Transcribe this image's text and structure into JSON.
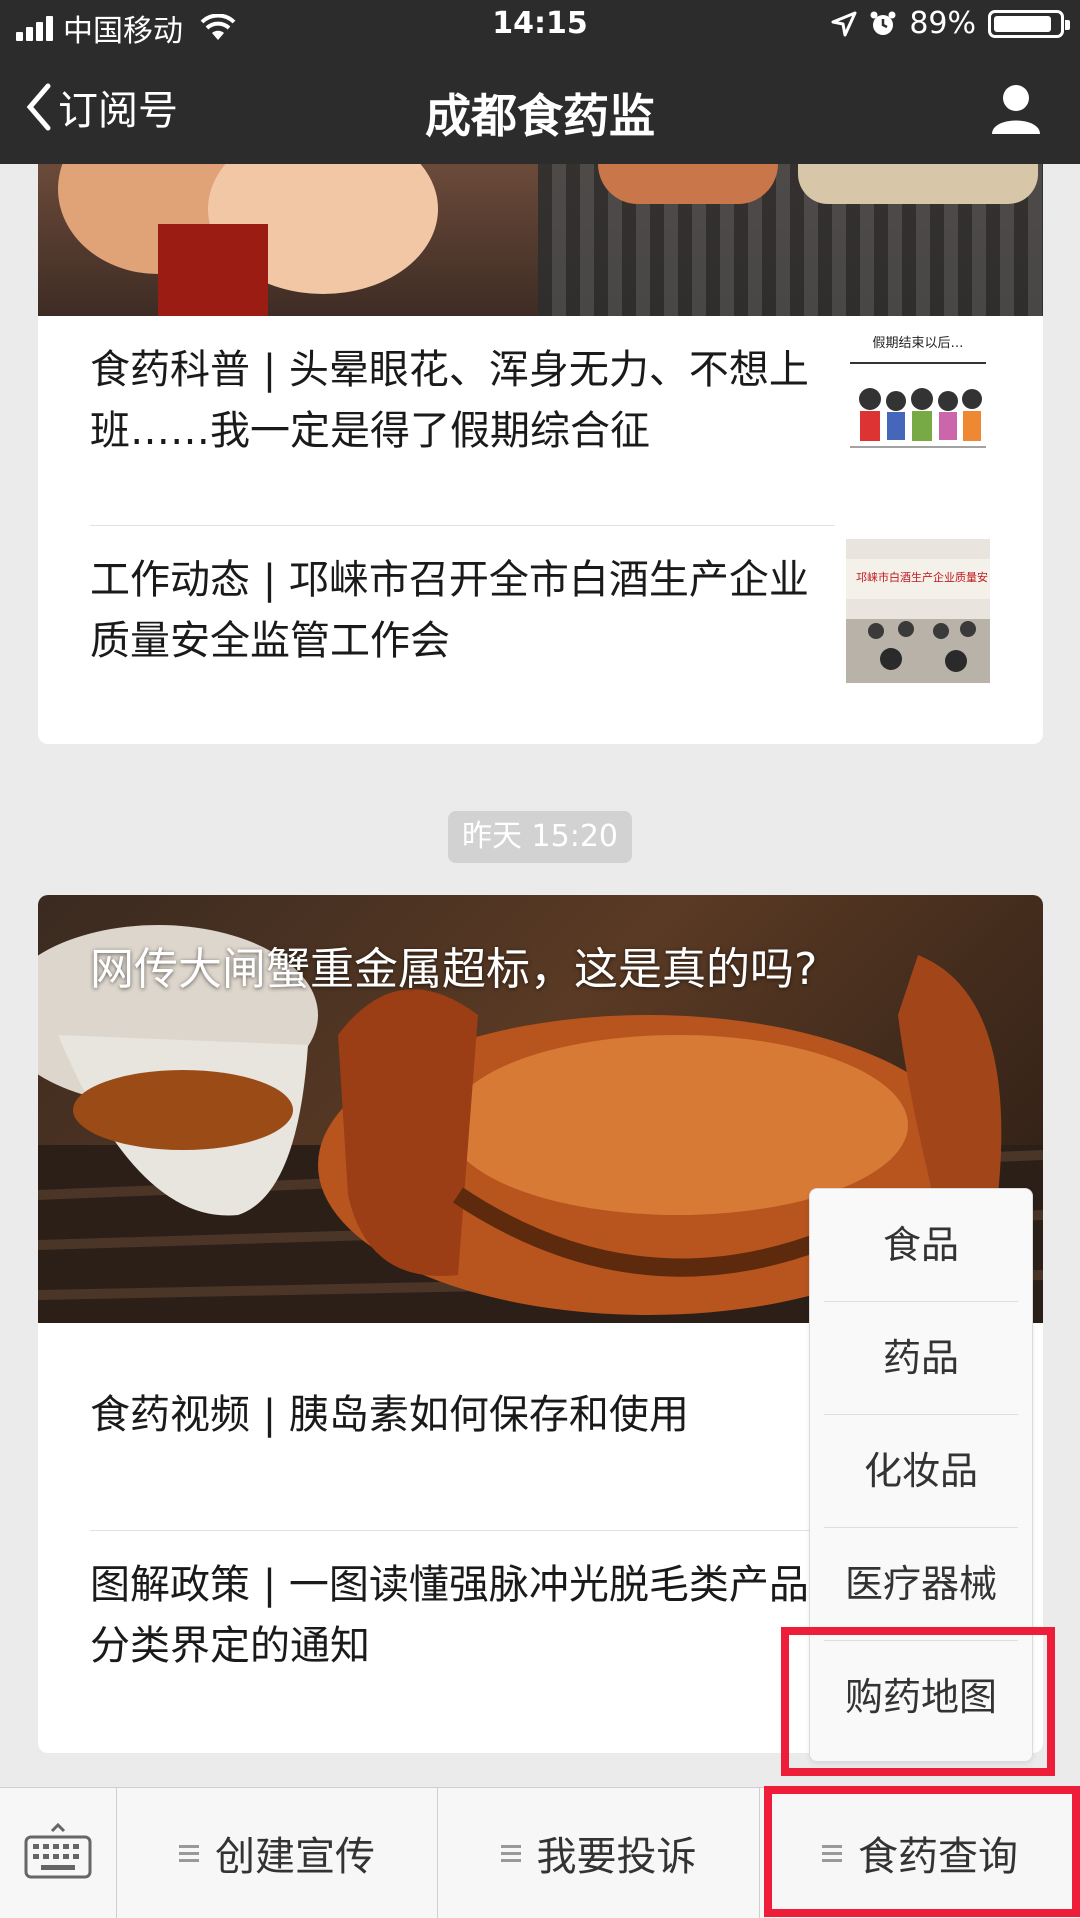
{
  "status_bar": {
    "carrier": "中国移动",
    "time": "14:15",
    "battery": "89%",
    "battery_level": 0.89
  },
  "nav": {
    "back_label": "订阅号",
    "title": "成都食药监"
  },
  "feed": {
    "group1": {
      "articles": [
        {
          "title": "食药科普 | 头晕眼花、浑身无力、不想上班……我一定是得了假期综合征",
          "thumb_caption": "假期结束以后…"
        },
        {
          "title": "工作动态 | 邛崃市召开全市白酒生产企业质量安全监管工作会",
          "thumb_caption": "邛崃市白酒生产企业质量安"
        }
      ]
    },
    "timestamp": "昨天 15:20",
    "group2": {
      "headline": "网传大闸蟹重金属超标，这是真的吗?",
      "articles": [
        {
          "title": "食药视频 | 胰岛素如何保存和使用"
        },
        {
          "title": "图解政策 | 一图读懂强脉冲光脱毛类产品分类界定的通知"
        }
      ]
    }
  },
  "popup_menu": {
    "items": [
      "食品",
      "药品",
      "化妆品",
      "医疗器械",
      "购药地图"
    ]
  },
  "bottom_menu": {
    "items": [
      "创建宣传",
      "我要投诉",
      "食药查询"
    ]
  },
  "colors": {
    "nav_bg": "#2c2c2c",
    "highlight": "#ee1e3a"
  }
}
